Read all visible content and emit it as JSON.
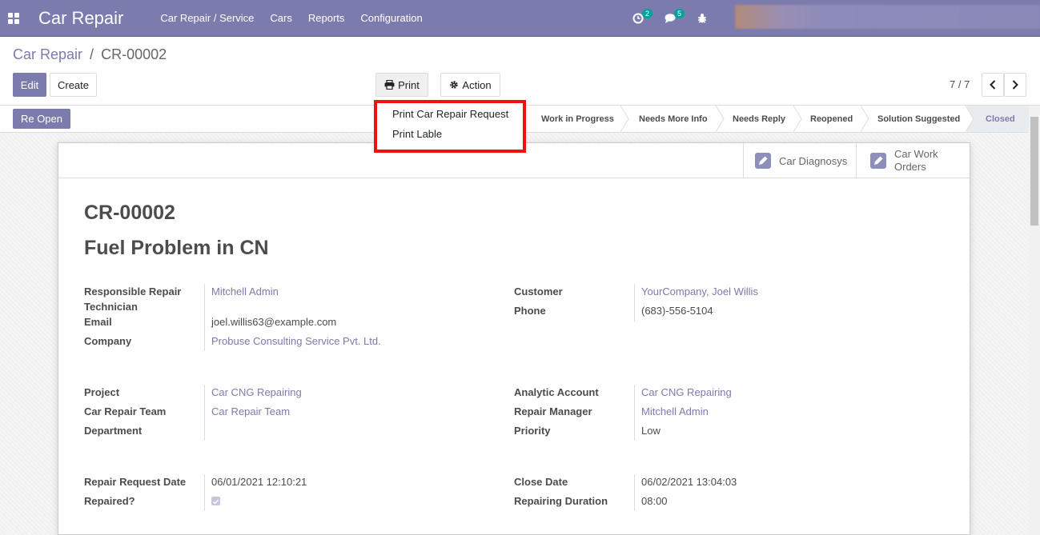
{
  "navbar": {
    "app_name": "Car Repair",
    "menu": [
      "Car Repair / Service",
      "Cars",
      "Reports",
      "Configuration"
    ],
    "activity_count": "2",
    "messages_count": "5"
  },
  "breadcrumb": {
    "parent": "Car Repair",
    "separator": "/",
    "current": "CR-00002"
  },
  "buttons": {
    "edit": "Edit",
    "create": "Create",
    "print": "Print",
    "action": "Action",
    "reopen": "Re Open"
  },
  "pager": {
    "value": "7 / 7"
  },
  "print_menu": {
    "items": [
      "Print Car Repair Request",
      "Print Lable"
    ]
  },
  "stages": [
    "Work in Progress",
    "Needs More Info",
    "Needs Reply",
    "Reopened",
    "Solution Suggested",
    "Closed"
  ],
  "smart_buttons": {
    "diagnosys": "Car Diagnosys",
    "work_orders_1": "Car Work",
    "work_orders_2": "Orders"
  },
  "record": {
    "code": "CR-00002",
    "subject": "Fuel Problem in CN",
    "labels": {
      "technician_1": "Responsible Repair",
      "technician_2": "Technician",
      "email": "Email",
      "company": "Company",
      "customer": "Customer",
      "phone": "Phone",
      "project": "Project",
      "team": "Car Repair Team",
      "department": "Department",
      "analytic": "Analytic Account",
      "manager": "Repair Manager",
      "priority": "Priority",
      "request_date": "Repair Request Date",
      "repaired": "Repaired?",
      "close_date": "Close Date",
      "duration": "Repairing Duration"
    },
    "values": {
      "technician": "Mitchell Admin",
      "email": "joel.willis63@example.com",
      "company": "Probuse Consulting Service Pvt. Ltd.",
      "customer": "YourCompany, Joel Willis",
      "phone": "(683)-556-5104",
      "project": "Car CNG Repairing",
      "team": "Car Repair Team",
      "analytic": "Car CNG Repairing",
      "manager": "Mitchell Admin",
      "priority": "Low",
      "request_date": "06/01/2021 12:10:21",
      "repaired": true,
      "close_date": "06/02/2021 13:04:03",
      "duration": "08:00"
    }
  },
  "colors": {
    "brand": "#7c7bad",
    "highlight": "#ee1111",
    "badge": "#00a09d"
  }
}
